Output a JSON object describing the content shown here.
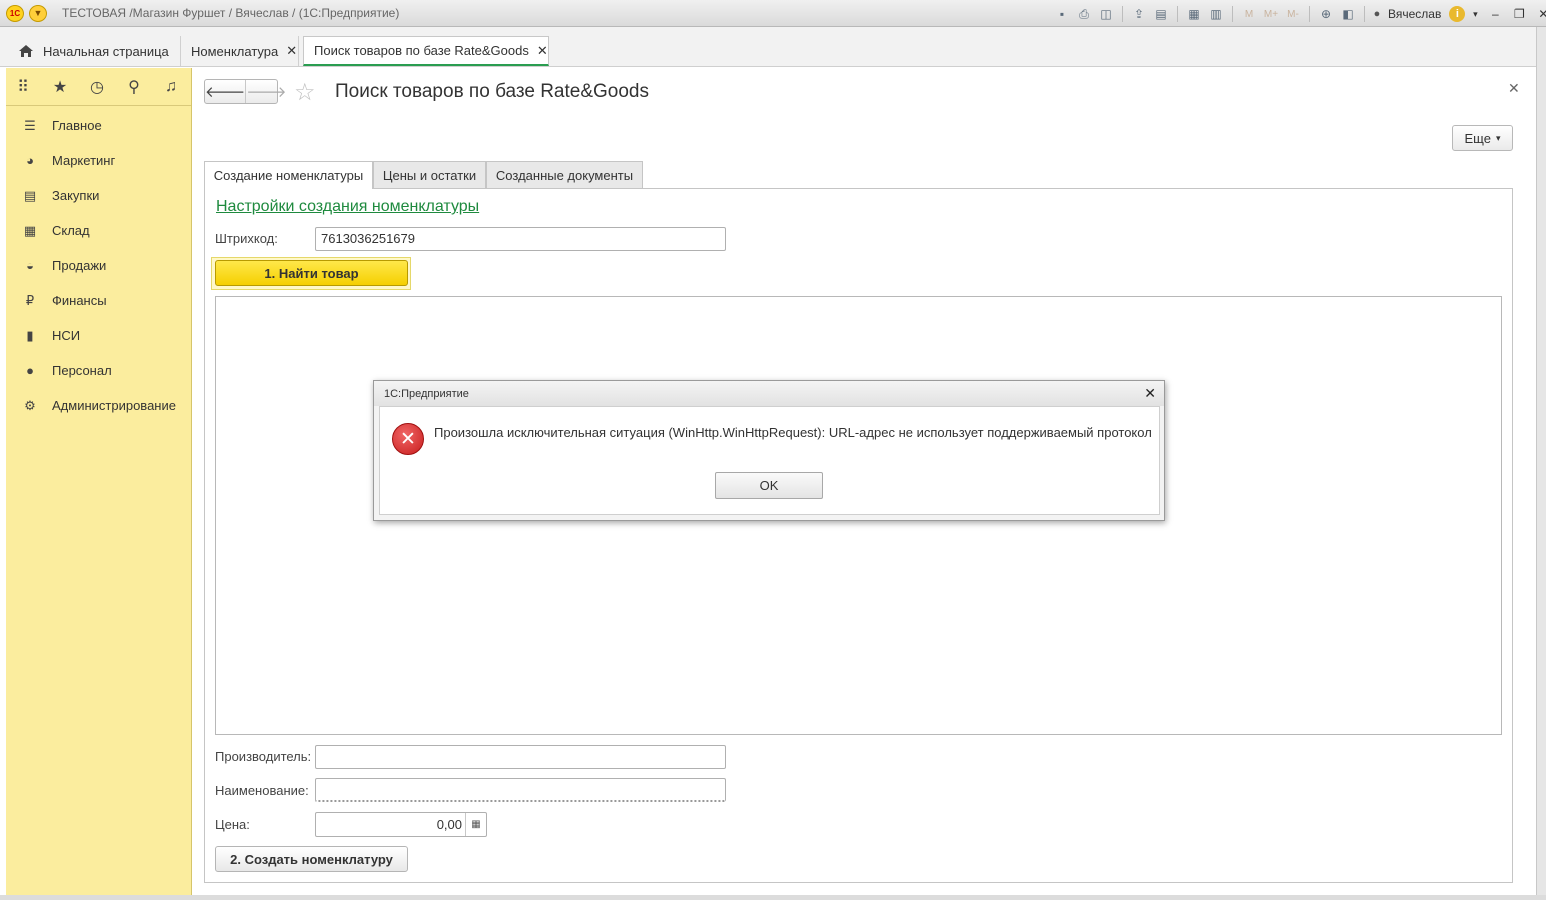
{
  "window": {
    "logo_text": "1С",
    "title": "ТЕСТОВАЯ /Магазин Фуршет / Вячеслав /  (1С:Предприятие)",
    "user": "Вячеслав",
    "toolbar_m": "M",
    "toolbar_mplus": "M+",
    "toolbar_mminus": "M-"
  },
  "open_tabs": [
    {
      "label": "Начальная страница"
    },
    {
      "label": "Номенклатура"
    },
    {
      "label": "Поиск товаров по базе Rate&Goods"
    }
  ],
  "sidebar": {
    "items": [
      {
        "label": "Главное",
        "icon": "menu-lines-icon"
      },
      {
        "label": "Маркетинг",
        "icon": "pie-chart-icon"
      },
      {
        "label": "Закупки",
        "icon": "cart-icon"
      },
      {
        "label": "Склад",
        "icon": "warehouse-grid-icon"
      },
      {
        "label": "Продажи",
        "icon": "basket-icon"
      },
      {
        "label": "Финансы",
        "icon": "ruble-coin-icon"
      },
      {
        "label": "НСИ",
        "icon": "book-icon"
      },
      {
        "label": "Персонал",
        "icon": "person-icon"
      },
      {
        "label": "Администрирование",
        "icon": "gear-icon"
      }
    ]
  },
  "form": {
    "title": "Поиск товаров по базе Rate&Goods",
    "more_label": "Еще",
    "tabs": [
      {
        "label": "Создание номенклатуры"
      },
      {
        "label": "Цены и остатки"
      },
      {
        "label": "Созданные документы"
      }
    ],
    "settings_link": "Настройки создания номенклатуры",
    "barcode_label": "Штрихкод:",
    "barcode_value": "7613036251679",
    "find_button": "1. Найти товар",
    "manufacturer_label": "Производитель:",
    "manufacturer_value": "",
    "name_label": "Наименование:",
    "name_value": "",
    "price_label": "Цена:",
    "price_value": "0,00",
    "create_button": "2. Создать номенклатуру"
  },
  "dialog": {
    "title": "1С:Предприятие",
    "message": "Произошла исключительная ситуация (WinHttp.WinHttpRequest): URL-адрес не использует поддерживаемый протокол",
    "ok_label": "OK"
  }
}
